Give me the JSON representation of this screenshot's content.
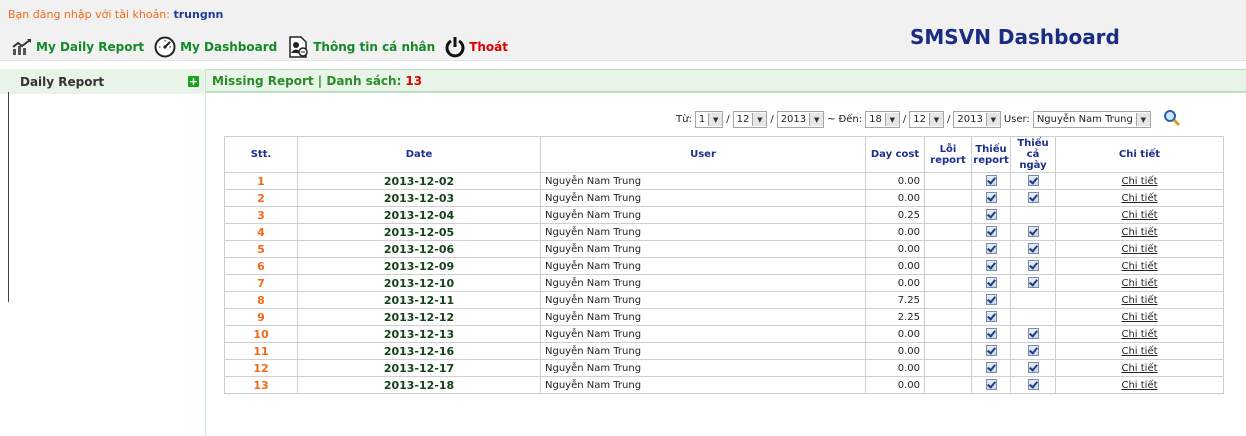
{
  "header": {
    "login_prefix": "Bạn đăng nhập với tài khoản:",
    "username": "trungnn",
    "app_title": "SMSVN Dashboard",
    "nav": [
      {
        "label": "My Daily Report",
        "icon": "chart-icon"
      },
      {
        "label": "My Dashboard",
        "icon": "speedometer-icon"
      },
      {
        "label": "Thông tin cá nhân",
        "icon": "user-info-icon"
      },
      {
        "label": "Thoát",
        "icon": "power-icon"
      }
    ]
  },
  "sidebar": {
    "title": "Daily Report"
  },
  "panel": {
    "title": "Missing Report | Danh sách:",
    "count": "13"
  },
  "filters": {
    "from_label": "Từ:",
    "from": {
      "day": "1",
      "month": "12",
      "year": "2013"
    },
    "tilde": "~",
    "to_label": "Đến:",
    "to": {
      "day": "18",
      "month": "12",
      "year": "2013"
    },
    "user_label": "User:",
    "user": "Nguyễn Nam Trung",
    "slash": "/"
  },
  "table": {
    "headers": {
      "stt": "Stt.",
      "date": "Date",
      "user": "User",
      "day_cost": "Day cost",
      "loi_report": "Lỗi report",
      "thieu_report": "Thiếu report",
      "thieu_ca_ngay": "Thiếu cả ngày",
      "chi_tiet": "Chi tiết"
    },
    "rows": [
      {
        "stt": "1",
        "date": "2013-12-02",
        "user": "Nguyễn Nam Trung",
        "cost": "0.00",
        "thieu_report": true,
        "thieu_ca_ngay": true,
        "link": "Chi tiết"
      },
      {
        "stt": "2",
        "date": "2013-12-03",
        "user": "Nguyễn Nam Trung",
        "cost": "0.00",
        "thieu_report": true,
        "thieu_ca_ngay": true,
        "link": "Chi tiết"
      },
      {
        "stt": "3",
        "date": "2013-12-04",
        "user": "Nguyễn Nam Trung",
        "cost": "0.25",
        "thieu_report": true,
        "thieu_ca_ngay": false,
        "link": "Chi tiết"
      },
      {
        "stt": "4",
        "date": "2013-12-05",
        "user": "Nguyễn Nam Trung",
        "cost": "0.00",
        "thieu_report": true,
        "thieu_ca_ngay": true,
        "link": "Chi tiết"
      },
      {
        "stt": "5",
        "date": "2013-12-06",
        "user": "Nguyễn Nam Trung",
        "cost": "0.00",
        "thieu_report": true,
        "thieu_ca_ngay": true,
        "link": "Chi tiết"
      },
      {
        "stt": "6",
        "date": "2013-12-09",
        "user": "Nguyễn Nam Trung",
        "cost": "0.00",
        "thieu_report": true,
        "thieu_ca_ngay": true,
        "link": "Chi tiết"
      },
      {
        "stt": "7",
        "date": "2013-12-10",
        "user": "Nguyễn Nam Trung",
        "cost": "0.00",
        "thieu_report": true,
        "thieu_ca_ngay": true,
        "link": "Chi tiết"
      },
      {
        "stt": "8",
        "date": "2013-12-11",
        "user": "Nguyễn Nam Trung",
        "cost": "7.25",
        "thieu_report": true,
        "thieu_ca_ngay": false,
        "link": "Chi tiết"
      },
      {
        "stt": "9",
        "date": "2013-12-12",
        "user": "Nguyễn Nam Trung",
        "cost": "2.25",
        "thieu_report": true,
        "thieu_ca_ngay": false,
        "link": "Chi tiết"
      },
      {
        "stt": "10",
        "date": "2013-12-13",
        "user": "Nguyễn Nam Trung",
        "cost": "0.00",
        "thieu_report": true,
        "thieu_ca_ngay": true,
        "link": "Chi tiết"
      },
      {
        "stt": "11",
        "date": "2013-12-16",
        "user": "Nguyễn Nam Trung",
        "cost": "0.00",
        "thieu_report": true,
        "thieu_ca_ngay": true,
        "link": "Chi tiết"
      },
      {
        "stt": "12",
        "date": "2013-12-17",
        "user": "Nguyễn Nam Trung",
        "cost": "0.00",
        "thieu_report": true,
        "thieu_ca_ngay": true,
        "link": "Chi tiết"
      },
      {
        "stt": "13",
        "date": "2013-12-18",
        "user": "Nguyễn Nam Trung",
        "cost": "0.00",
        "thieu_report": true,
        "thieu_ca_ngay": true,
        "link": "Chi tiết"
      }
    ]
  },
  "colors": {
    "accent_green": "#138a26",
    "stt_orange": "#ef6a1a",
    "title_blue": "#1b2d83",
    "logout_red": "#e00000"
  }
}
